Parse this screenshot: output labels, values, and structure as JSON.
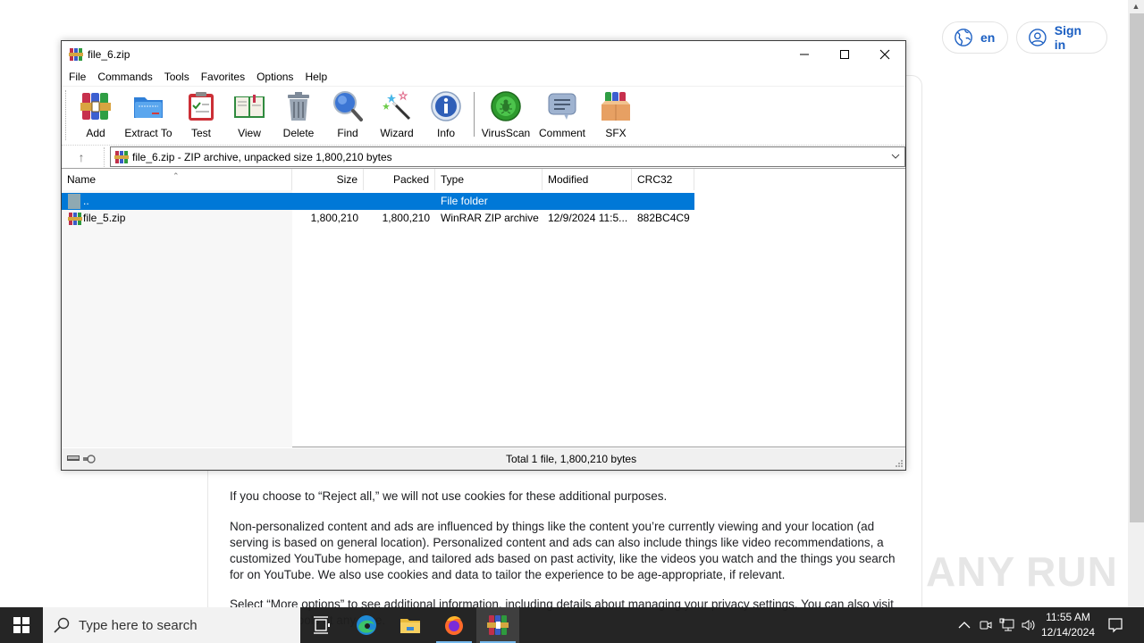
{
  "web": {
    "lang_button": "en",
    "signin_button": "Sign in",
    "paragraphs": [
      "If you choose to “Reject all,” we will not use cookies for these additional purposes.",
      "Non-personalized content and ads are influenced by things like the content you’re currently viewing and your location (ad serving is based on general location). Personalized content and ads can also include things like video recommendations, a customized YouTube homepage, and tailored ads based on past activity, like the videos you watch and the things you search for on YouTube. We also use cookies and data to tailor the experience to be age-appropriate, if relevant.",
      "Select “More options” to see additional information, including details about managing your privacy settings. You can also visit g.co/privacytools at any time."
    ],
    "watermark": "ANY RUN"
  },
  "window": {
    "title": "file_6.zip",
    "menu": [
      "File",
      "Commands",
      "Tools",
      "Favorites",
      "Options",
      "Help"
    ],
    "toolbar": [
      {
        "label": "Add",
        "icon": "add-archive-icon"
      },
      {
        "label": "Extract To",
        "icon": "extract-folder-icon"
      },
      {
        "label": "Test",
        "icon": "test-clipboard-icon"
      },
      {
        "label": "View",
        "icon": "view-book-icon"
      },
      {
        "label": "Delete",
        "icon": "trash-icon"
      },
      {
        "label": "Find",
        "icon": "magnifier-icon"
      },
      {
        "label": "Wizard",
        "icon": "magic-wand-icon"
      },
      {
        "label": "Info",
        "icon": "info-icon"
      },
      {
        "label": "VirusScan",
        "icon": "virus-scan-icon"
      },
      {
        "label": "Comment",
        "icon": "comment-icon"
      },
      {
        "label": "SFX",
        "icon": "sfx-box-icon"
      }
    ],
    "address": "file_6.zip - ZIP archive, unpacked size 1,800,210 bytes",
    "columns": [
      "Name",
      "Size",
      "Packed",
      "Type",
      "Modified",
      "CRC32"
    ],
    "rows": [
      {
        "name": "..",
        "size": "",
        "packed": "",
        "type": "File folder",
        "modified": "",
        "crc": "",
        "selected": true
      },
      {
        "name": "file_5.zip",
        "size": "1,800,210",
        "packed": "1,800,210",
        "type": "WinRAR ZIP archive",
        "modified": "12/9/2024 11:5...",
        "crc": "882BC4C9",
        "selected": false
      }
    ],
    "status": "Total 1 file, 1,800,210 bytes"
  },
  "taskbar": {
    "search_placeholder": "Type here to search",
    "time": "11:55 AM",
    "date": "12/14/2024"
  },
  "colors": {
    "selection": "#0078d7",
    "link_blue": "#1a5ec2",
    "taskbar": "#1e1e1e"
  }
}
